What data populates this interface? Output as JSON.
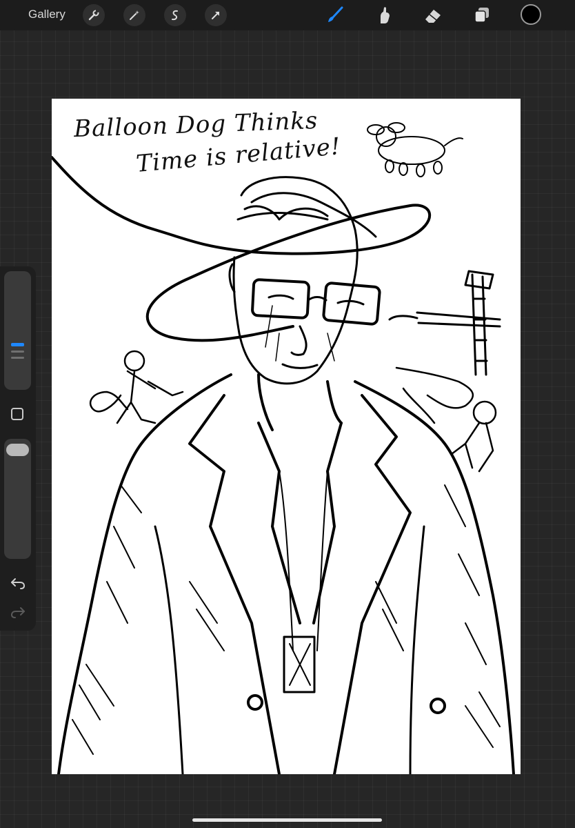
{
  "toolbar": {
    "gallery_label": "Gallery",
    "left_tools": [
      "wrench-icon",
      "magic-wand-icon",
      "selection-icon",
      "transform-arrow-icon"
    ],
    "right_tools": [
      "brush-icon",
      "smudge-icon",
      "eraser-icon",
      "layers-icon"
    ],
    "active_tool": "brush-icon",
    "active_color": "#000000",
    "accent_color": "#1e88ff"
  },
  "sidebar": {
    "brush_size_level": 0.58,
    "opacity_level": 1.0,
    "controls": [
      "brush-size-slider",
      "modify-button",
      "opacity-slider",
      "undo-icon",
      "redo-icon"
    ]
  },
  "canvas": {
    "background": "#ffffff",
    "caption_line_1": "Balloon Dog Thinks",
    "caption_line_2": "Time is relative!"
  }
}
